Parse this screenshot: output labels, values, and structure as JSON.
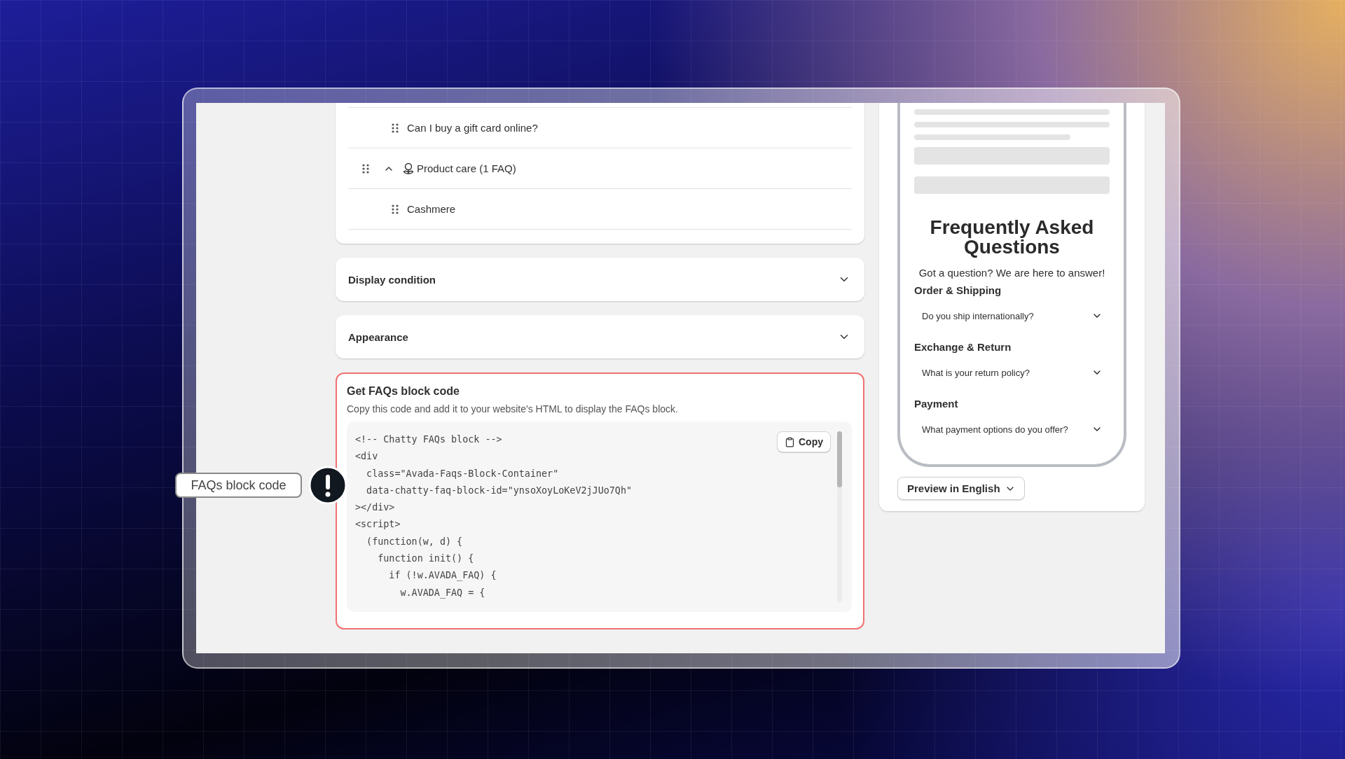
{
  "faq_list": {
    "items": [
      {
        "kind": "question",
        "label": "Can I buy a gift card online?"
      },
      {
        "kind": "category",
        "label": "Product care (1 FAQ)",
        "expanded": true,
        "children": [
          {
            "label": "Cashmere"
          }
        ]
      }
    ]
  },
  "sections": [
    {
      "title": "Display condition",
      "expanded": false
    },
    {
      "title": "Appearance",
      "expanded": false
    }
  ],
  "code_block": {
    "title": "Get FAQs block code",
    "description": "Copy this code and add it to your website's HTML to display the FAQs block.",
    "highlighted": true,
    "copy_button": "Copy",
    "lines": [
      "<!-- Chatty FAQs block -->",
      "<div",
      "  class=\"Avada-Faqs-Block-Container\"",
      "  data-chatty-faq-block-id=\"ynsoXoyLoKeV2jJUo7Qh\"",
      "></div>",
      "<script>",
      "  (function(w, d) {",
      "    function init() {",
      "      if (!w.AVADA_FAQ) {",
      "        w.AVADA_FAQ = {"
    ]
  },
  "preview": {
    "title": "Frequently Asked Questions",
    "subtitle": "Got a question? We are here to answer!",
    "groups": [
      {
        "name": "Order & Shipping",
        "questions": [
          "Do you ship internationally?"
        ]
      },
      {
        "name": "Exchange & Return",
        "questions": [
          "What is your return policy?"
        ]
      },
      {
        "name": "Payment",
        "questions": [
          "What payment options do you offer?"
        ]
      }
    ],
    "language_button": "Preview in English"
  },
  "callout": {
    "label": "FAQs block code"
  }
}
